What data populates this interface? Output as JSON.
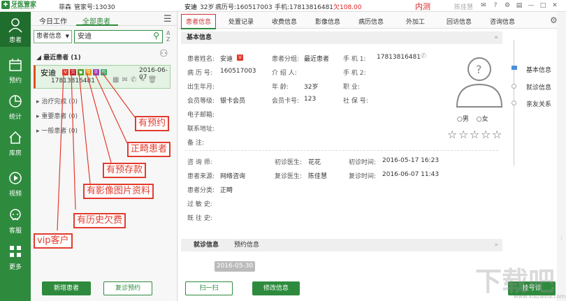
{
  "topbar": {
    "logo_name": "牙医管家",
    "logo_sub": "Dental360.cn",
    "user": "菲森",
    "admin": "管家号:13030",
    "patient_name": "安迪",
    "patient_age": "32岁",
    "record_no": "病历号:160517003",
    "phone": "手机:17813816481",
    "debt": "欠108.00",
    "test": "内测",
    "doctor": "陈佳慧"
  },
  "sidebar": {
    "items": [
      {
        "label": "患者",
        "icon": "person-icon"
      },
      {
        "label": "预约",
        "icon": "calendar-icon"
      },
      {
        "label": "统计",
        "icon": "pie-chart-icon"
      },
      {
        "label": "库房",
        "icon": "house-icon"
      },
      {
        "label": "视频",
        "icon": "play-icon"
      },
      {
        "label": "客服",
        "icon": "support-icon"
      },
      {
        "label": "更多",
        "icon": "grid-icon"
      }
    ]
  },
  "left": {
    "tab_today": "今日工作",
    "tab_all": "全部患者",
    "filter": "患者信息",
    "search_value": "安迪",
    "recent": "最近患者 (1)",
    "card_name": "安迪",
    "card_date": "2016-06-07",
    "card_phone": "17813816481",
    "groups": [
      "治疗完成 (0)",
      "重要患者 (0)",
      "一般患者 (0)"
    ],
    "btn_new": "新增患者",
    "btn_revisit": "复诊预约"
  },
  "callouts": [
    "有预约",
    "正畸患者",
    "有预存款",
    "有影像图片资料",
    "有历史欠费",
    "vip客户"
  ],
  "main": {
    "tabs": [
      "患者信息",
      "处置记录",
      "收费信息",
      "影像信息",
      "病历信息",
      "外加工",
      "回访信息",
      "咨询信息"
    ],
    "section_basic": "基本信息",
    "fields": {
      "name_l": "患者姓名:",
      "name_v": "安迪",
      "group_l": "患者分组:",
      "group_v": "最近患者",
      "phone1_l": "手 机 1:",
      "phone1_v": "17813816481",
      "record_l": "病 历 号:",
      "record_v": "160517003",
      "intro_l": "介 绍 人:",
      "phone2_l": "手 机 2:",
      "birth_l": "出生年月:",
      "age_l": "年    龄:",
      "age_v": "32岁",
      "job_l": "职    业:",
      "level_l": "会员等级:",
      "level_v": "银卡会员",
      "card_l": "会员卡号:",
      "card_v": "123",
      "ss_l": "社 保 号:",
      "email_l": "电子邮箱:",
      "addr_l": "联系地址:",
      "note_l": "备    注:",
      "consult_l": "咨 询 师:",
      "first_doc_l": "初诊医生:",
      "first_doc_v": "花花",
      "first_time_l": "初诊时间:",
      "first_time_v": "2016-05-17 16:23",
      "source_l": "患者来源:",
      "source_v": "网络咨询",
      "re_doc_l": "复诊医生:",
      "re_doc_v": "陈佳慧",
      "re_time_l": "复诊时间:",
      "re_time_v": "2016-06-07 11:43",
      "cat_l": "患者分类:",
      "cat_v": "正畸",
      "allergy_l": "过 敏 史:",
      "history_l": "既 往 史:"
    },
    "gender_m": "男",
    "gender_f": "女",
    "sub_tabs": [
      "就诊信息",
      "预约信息"
    ],
    "visit_date": "2016-05-30",
    "btn_scan": "扫一扫",
    "btn_edit": "修改信息",
    "btn_register": "挂号诊",
    "timeline": [
      "基本信息",
      "就诊信息",
      "亲友关系"
    ]
  },
  "watermark": "下载吧",
  "watermark_url": "www.xiazaiba.com"
}
